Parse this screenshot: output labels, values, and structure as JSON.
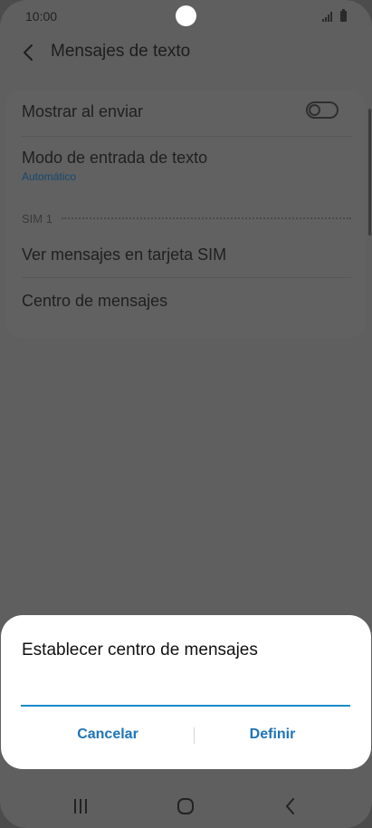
{
  "status_bar": {
    "time": "10:00"
  },
  "header": {
    "title": "Mensajes de texto"
  },
  "settings": {
    "show_on_send": {
      "label": "Mostrar al enviar",
      "enabled": false
    },
    "input_mode": {
      "label": "Modo de entrada de texto",
      "value": "Automático"
    },
    "section_sim": "SIM 1",
    "view_sim_messages": {
      "label": "Ver mensajes en tarjeta SIM"
    },
    "message_center": {
      "label": "Centro de mensajes"
    }
  },
  "dialog": {
    "title": "Establecer centro de mensajes",
    "input_value": "",
    "cancel_label": "Cancelar",
    "confirm_label": "Definir"
  },
  "icons": {
    "back": "chevron-left-icon",
    "signal": "signal-icon",
    "battery": "battery-icon",
    "recents": "recent-apps-icon",
    "home": "home-icon",
    "nav_back": "nav-back-icon"
  },
  "colors": {
    "accent": "#1a8bc9",
    "button_text": "#1d74b8"
  }
}
